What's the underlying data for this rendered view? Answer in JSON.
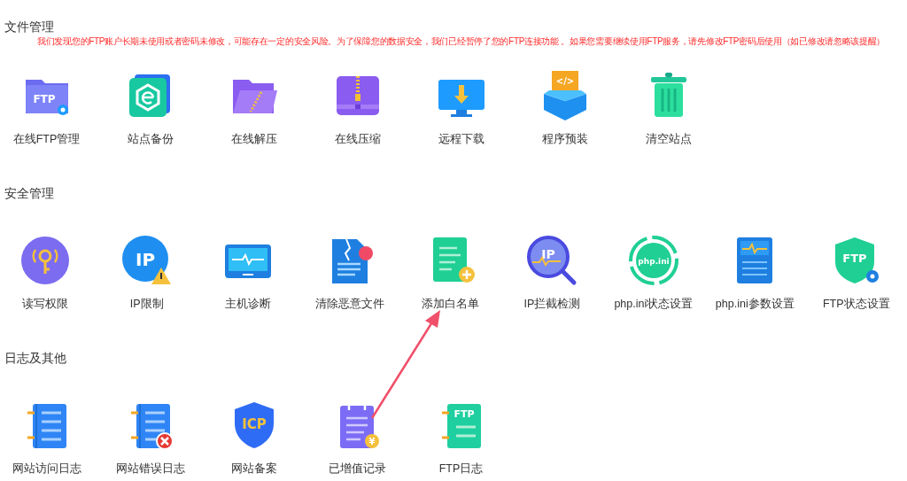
{
  "sections": [
    {
      "title": "文件管理",
      "warning": "我们发现您的FTP账户长期未使用或者密码未修改，可能存在一定的安全风险。为了保障您的数据安全，我们已经暂停了您的FTP连接功能 。如果您需要继续使用FTP服务，请先修改FTP密码后使用（如已修改请忽略该提醒）",
      "tools": [
        {
          "label": "在线FTP管理",
          "kind": "ftp-folder",
          "icon_text": "FTP"
        },
        {
          "label": "站点备份",
          "kind": "backup"
        },
        {
          "label": "在线解压",
          "kind": "unzip"
        },
        {
          "label": "在线压缩",
          "kind": "zip"
        },
        {
          "label": "远程下载",
          "kind": "download"
        },
        {
          "label": "程序预装",
          "kind": "package",
          "icon_text": "</>"
        },
        {
          "label": "清空站点",
          "kind": "trash"
        }
      ]
    },
    {
      "title": "安全管理",
      "tools": [
        {
          "label": "读写权限",
          "kind": "key"
        },
        {
          "label": "IP限制",
          "kind": "ip-warning",
          "icon_text": "IP"
        },
        {
          "label": "主机诊断",
          "kind": "monitor"
        },
        {
          "label": "清除恶意文件",
          "kind": "clean-file"
        },
        {
          "label": "添加白名单",
          "kind": "whitelist"
        },
        {
          "label": "IP拦截检测",
          "kind": "ip-search",
          "icon_text": "IP"
        },
        {
          "label": "php.ini状态设置",
          "kind": "php-ring",
          "icon_text": "php.ini"
        },
        {
          "label": "php.ini参数设置",
          "kind": "php-params"
        },
        {
          "label": "FTP状态设置",
          "kind": "ftp-shield",
          "icon_text": "FTP"
        }
      ]
    },
    {
      "title": "日志及其他",
      "tools": [
        {
          "label": "网站访问日志",
          "kind": "log"
        },
        {
          "label": "网站错误日志",
          "kind": "log-error"
        },
        {
          "label": "网站备案",
          "kind": "icp",
          "icon_text": "ICP"
        },
        {
          "label": "已增值记录",
          "kind": "billing",
          "icon_text": "¥"
        },
        {
          "label": "FTP日志",
          "kind": "ftp-log",
          "icon_text": "FTP"
        }
      ]
    }
  ]
}
